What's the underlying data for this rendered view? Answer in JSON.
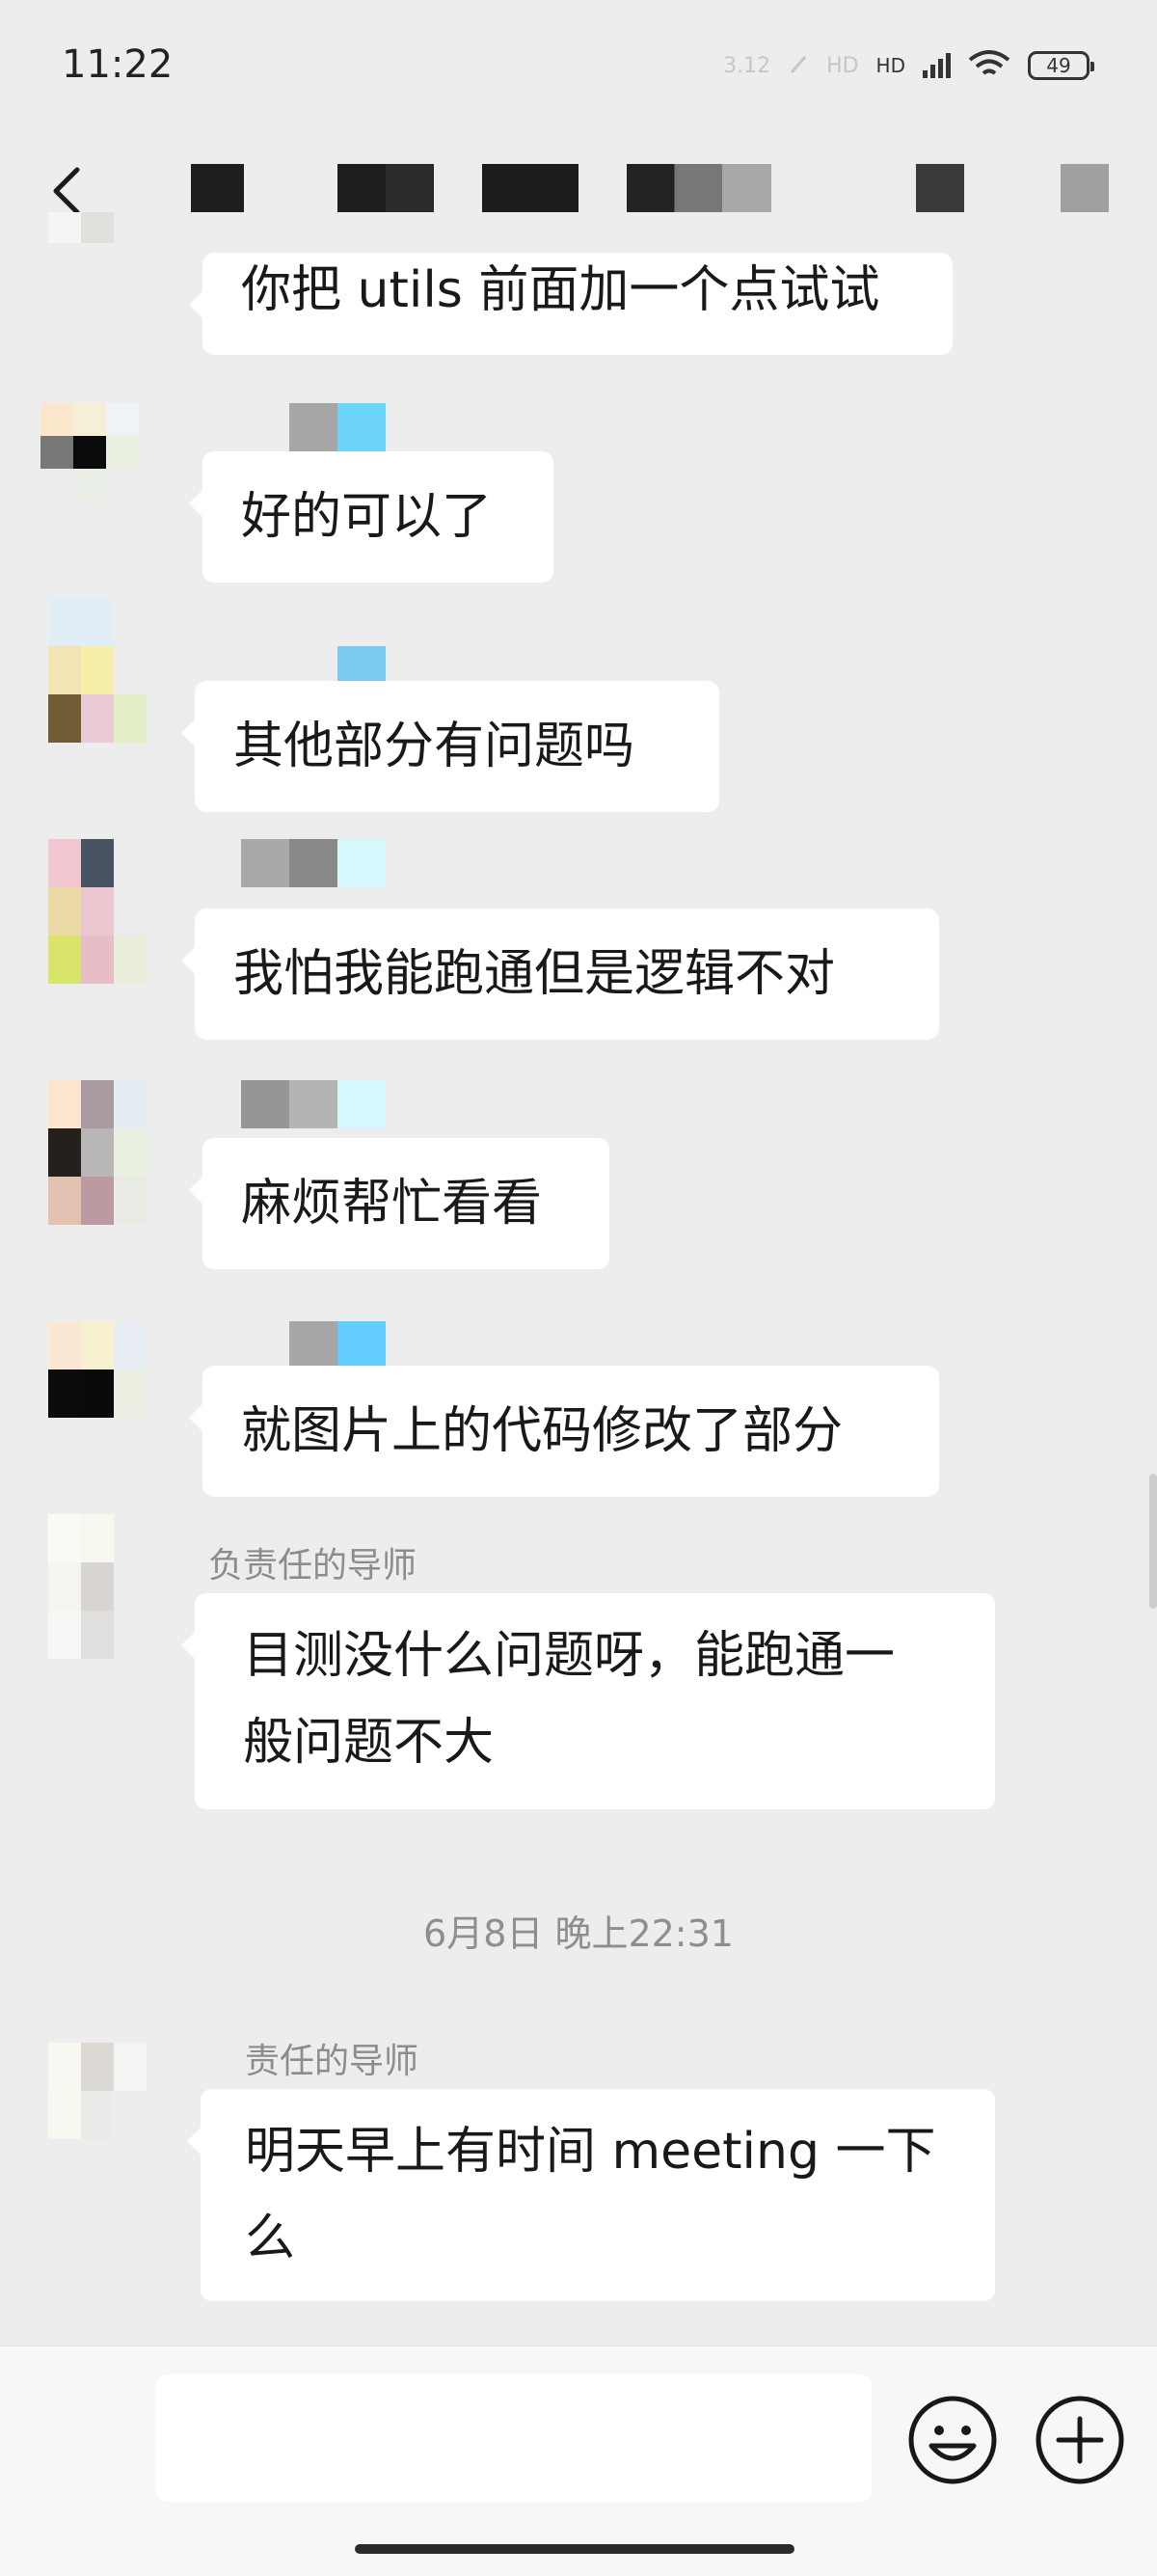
{
  "status_bar": {
    "time": "11:22",
    "speed": "3.12",
    "network_labels": [
      "HD",
      "HD"
    ],
    "battery": "49",
    "icons": [
      "network-speed-icon",
      "alarm-icon",
      "signal-icon",
      "wifi-icon",
      "battery-icon"
    ]
  },
  "nav": {
    "back_icon": "chevron-left-icon"
  },
  "messages": [
    {
      "text": "你把 utils 前面加一个点试试"
    },
    {
      "text": "好的可以了"
    },
    {
      "text": "其他部分有问题吗"
    },
    {
      "text": "我怕我能跑通但是逻辑不对"
    },
    {
      "text": "麻烦帮忙看看"
    },
    {
      "text": "就图片上的代码修改了部分"
    },
    {
      "sender": "负责任的导师",
      "lines": [
        "目测没什么问题呀，能跑通一",
        "般问题不大"
      ]
    },
    {
      "sender": "责任的导师",
      "lines": [
        "明天早上有时间 meeting 一下",
        "么"
      ]
    }
  ],
  "timestamp": "6月8日 晚上22:31",
  "input": {
    "value": "",
    "emoji_icon": "emoji-smile-icon",
    "plus_icon": "plus-circle-icon"
  },
  "colors": {
    "background": "#ededed",
    "bubble": "#ffffff",
    "input_bar": "#f7f7f7"
  }
}
